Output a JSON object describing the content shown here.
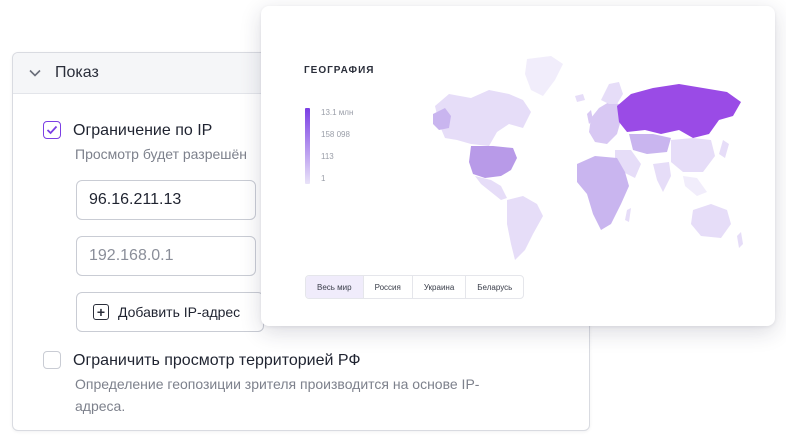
{
  "panel": {
    "title": "Показ",
    "ip_restriction": {
      "label": "Ограничение по IP",
      "hint": "Просмотр будет разрешён",
      "ip1": "96.16.211.13",
      "ip2_placeholder": "192.168.0.1",
      "add_label": "Добавить IP-адрес"
    },
    "rf_restriction": {
      "label": "Ограничить просмотр территорией РФ",
      "hint_line1": "Определение геопозиции зрителя производится на основе IP-",
      "hint_line2": "адреса."
    }
  },
  "geo_card": {
    "title": "ГЕОГРАФИЯ",
    "scale_labels": [
      "13.1 млн",
      "158 098",
      "113",
      "1"
    ],
    "tabs": [
      {
        "label": "Весь мир",
        "active": true
      },
      {
        "label": "Россия",
        "active": false
      },
      {
        "label": "Украина",
        "active": false
      },
      {
        "label": "Беларусь",
        "active": false
      }
    ]
  },
  "colors": {
    "accent": "#7b3fe4",
    "map_dark": "#9a4be6",
    "map_mid": "#b89ae8",
    "map_light": "#e6ddf8"
  },
  "icons": [
    "chevron-down-icon",
    "check-icon",
    "plus-square-icon"
  ]
}
